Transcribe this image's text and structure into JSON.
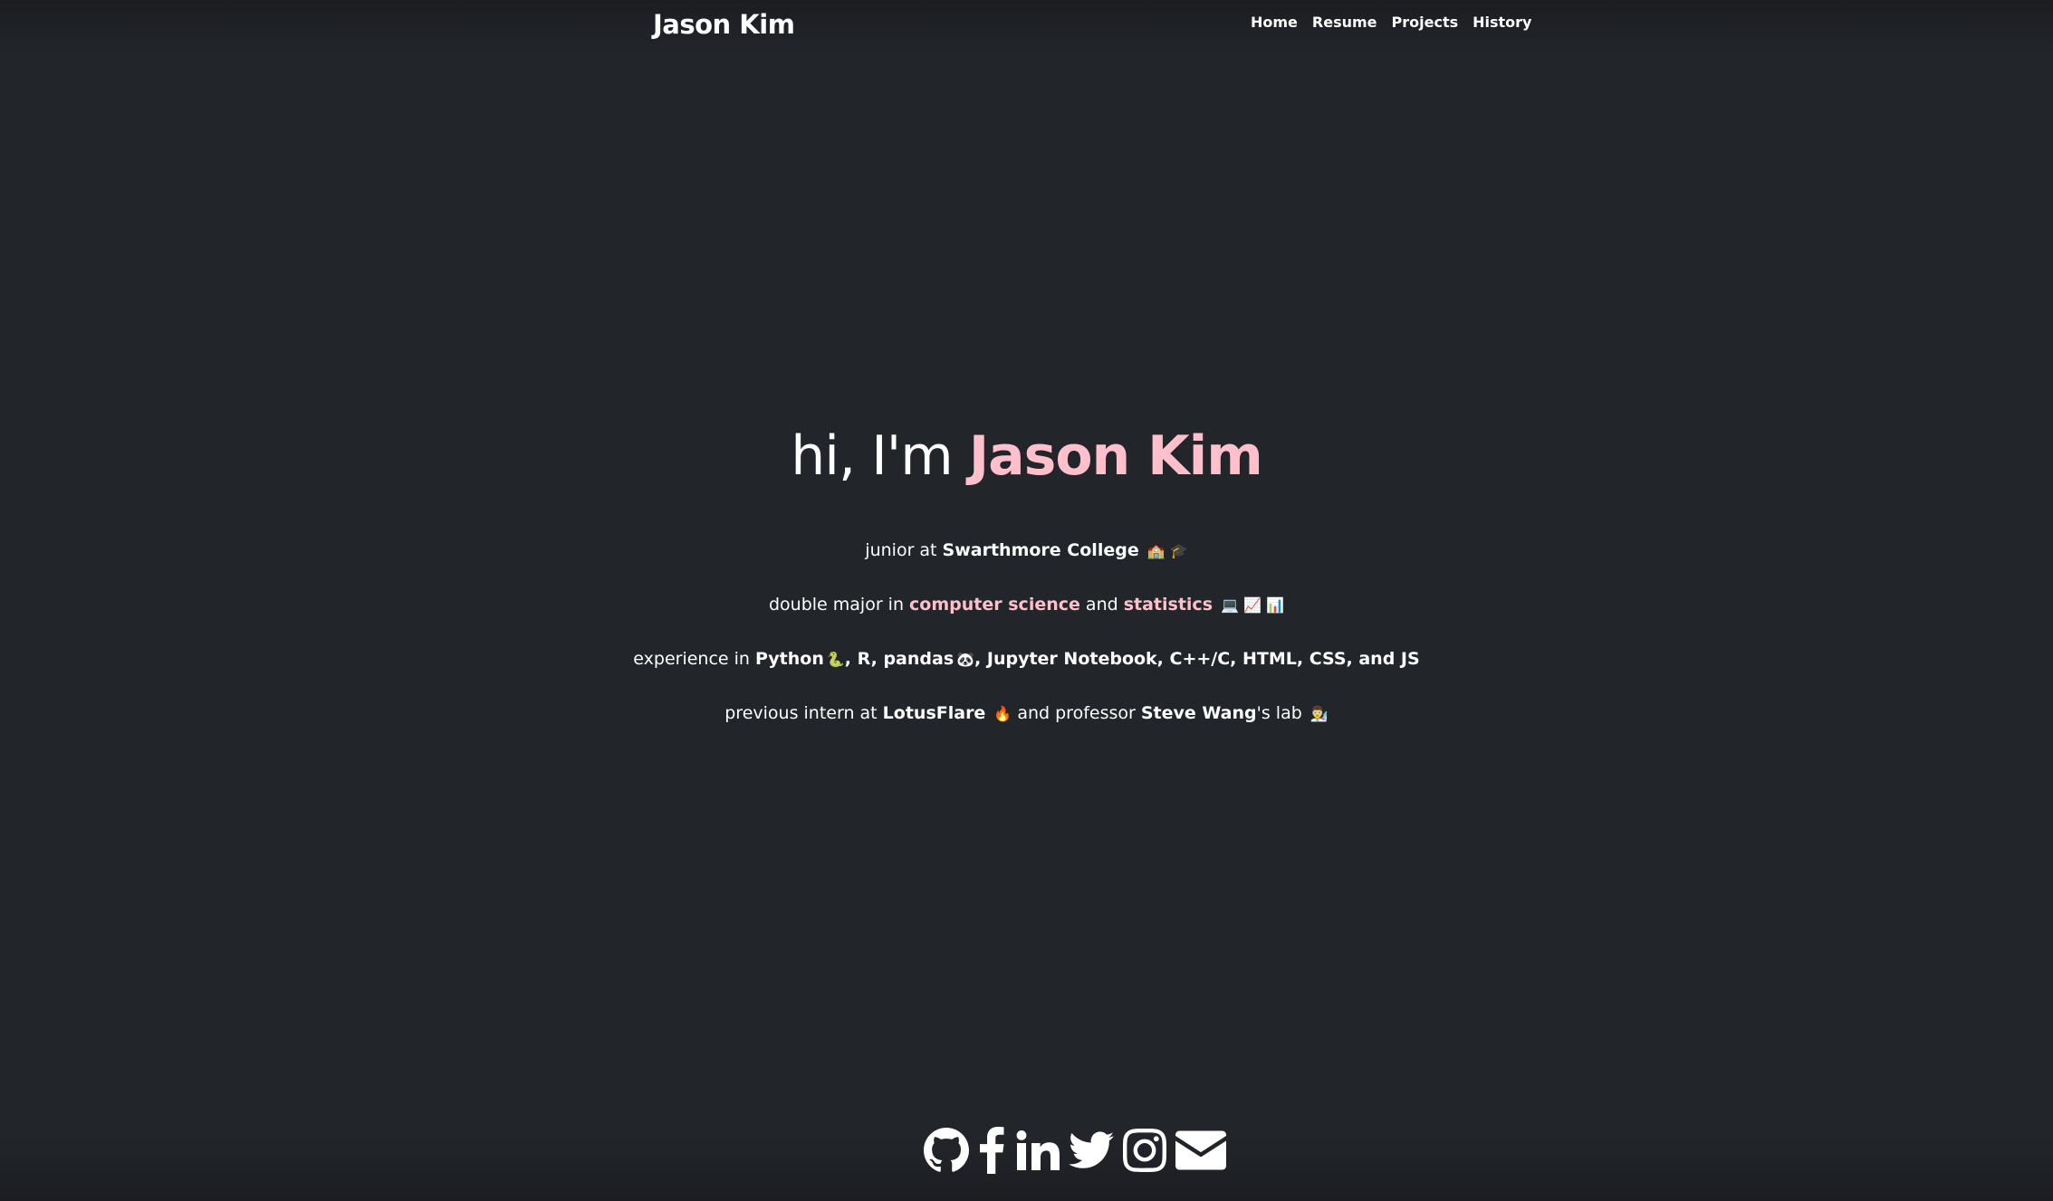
{
  "nav": {
    "brand": "Jason Kim",
    "links": [
      "Home",
      "Resume",
      "Projects",
      "History"
    ]
  },
  "hero": {
    "greeting": "hi, I'm ",
    "name": "Jason Kim"
  },
  "lines": {
    "l1": {
      "pre": "junior at ",
      "college": "Swarthmore College",
      "emoji": "🏫 🎓"
    },
    "l2": {
      "pre": "double major in ",
      "major1": "computer science",
      "mid": " and ",
      "major2": "statistics",
      "emoji": "💻 📈 📊"
    },
    "l3": {
      "pre": "experience in ",
      "python": "Python",
      "python_emoji": "🐍",
      "mid": ", R, pandas",
      "pandas_emoji": "🐼",
      "rest": ", Jupyter Notebook, C++/C, HTML, CSS, and JS"
    },
    "l4": {
      "pre": "previous intern at ",
      "company": "LotusFlare",
      "company_emoji": "🔥",
      "mid": " and professor ",
      "prof": "Steve Wang",
      "post": "'s lab",
      "lab_emoji": "👨‍🔬"
    }
  },
  "social": {
    "icons": [
      "github-icon",
      "facebook-icon",
      "linkedin-icon",
      "twitter-icon",
      "instagram-icon",
      "envelope-icon"
    ]
  },
  "colors": {
    "background": "#22252a",
    "accent": "#ffc0cb",
    "text": "#ffffff"
  }
}
